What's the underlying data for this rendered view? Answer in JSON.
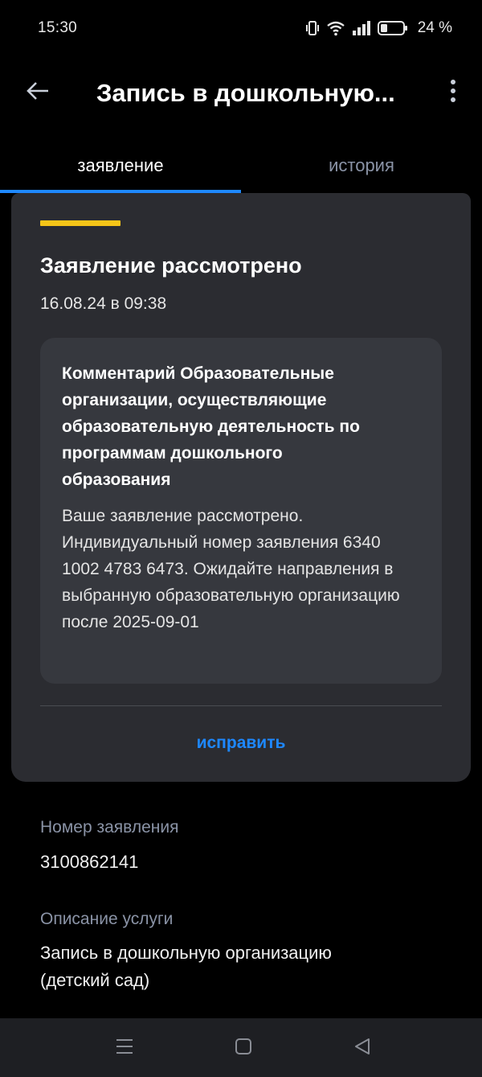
{
  "status_bar": {
    "time": "15:30",
    "battery": "24 %",
    "icons": [
      "vibrate-icon",
      "wifi-icon",
      "signal-icon",
      "battery-icon"
    ]
  },
  "app_bar": {
    "title": "Запись в дошкольную...",
    "back_icon": "arrow-left-icon",
    "menu_icon": "more-vert-icon"
  },
  "tabs": [
    {
      "label": "заявление",
      "active": true
    },
    {
      "label": "история",
      "active": false
    }
  ],
  "card": {
    "title": "Заявление рассмотрено",
    "date": "16.08.24 в 09:38",
    "comment_heading": "Комментарий Образовательные организации, осуществляющие образовательную деятельность по программам дошкольного образования",
    "comment_body": "Ваше заявление рассмотрено. Индивидуальный номер заявления 6340 1002 4783 6473. Ожидайте направления в выбранную образовательную организацию после 2025-09-01",
    "action_label": "исправить",
    "accent_color": "#f5c518"
  },
  "details": {
    "number_label": "Номер заявления",
    "number_value": "3100862141",
    "service_label": "Описание услуги",
    "service_value": "Запись в дошкольную организацию (детский сад)"
  },
  "nav_bar": {
    "icons": [
      "menu-icon",
      "home-square-icon",
      "back-triangle-icon"
    ]
  },
  "colors": {
    "accent_blue": "#1e88ff",
    "card_bg": "#2b2c31",
    "muted_text": "#8a93a6"
  }
}
